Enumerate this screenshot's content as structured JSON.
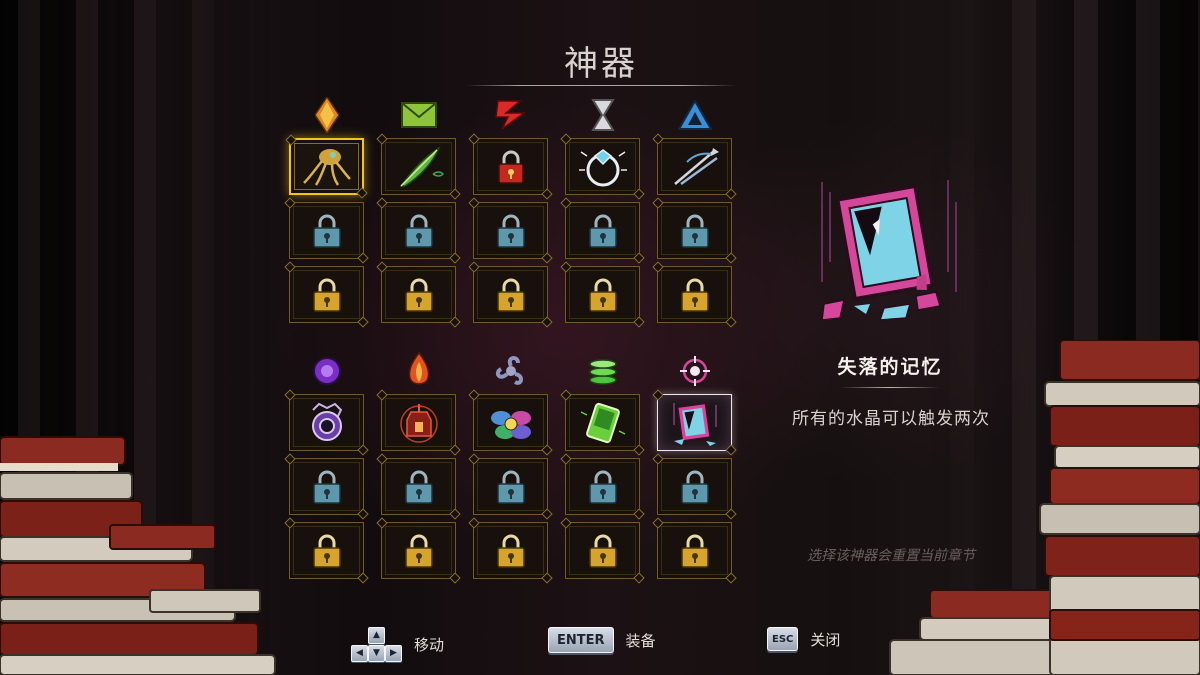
{
  "title": "神器",
  "colors": {
    "gold_frame": "#6f5a2c",
    "selected_frame": "#f2c41e",
    "lock_blue": "#5f98ad",
    "lock_gold": "#d6a42a",
    "accent_pink": "#d4479a",
    "accent_cyan": "#7ed3e6"
  },
  "grid_top": {
    "emblems": [
      "amber-diamond-icon",
      "green-envelope-icon",
      "red-rune-icon",
      "silver-hourglass-icon",
      "blue-triangle-icon"
    ],
    "columns": [
      {
        "unlocked": "tentacle-creature-artifact",
        "rows": [
          "unlocked",
          "locked-blue",
          "locked-gold"
        ]
      },
      {
        "unlocked": "green-feather-artifact",
        "rows": [
          "unlocked",
          "locked-blue",
          "locked-gold"
        ]
      },
      {
        "unlocked": "red-padlock-artifact",
        "rows": [
          "unlocked",
          "locked-blue",
          "locked-gold"
        ]
      },
      {
        "unlocked": "diamond-ring-artifact",
        "rows": [
          "unlocked",
          "locked-blue",
          "locked-gold"
        ]
      },
      {
        "unlocked": "arrows-artifact",
        "rows": [
          "unlocked",
          "locked-blue",
          "locked-gold"
        ]
      }
    ],
    "selected_column": 0
  },
  "grid_bottom": {
    "emblems": [
      "purple-orb-icon",
      "fire-gem-icon",
      "triskelion-icon",
      "green-stack-icon",
      "crosshair-icon"
    ],
    "columns": [
      {
        "unlocked": "purple-eye-artifact",
        "rows": [
          "unlocked",
          "locked-blue",
          "locked-gold"
        ]
      },
      {
        "unlocked": "red-lantern-artifact",
        "rows": [
          "unlocked",
          "locked-blue",
          "locked-gold"
        ]
      },
      {
        "unlocked": "flower-artifact",
        "rows": [
          "unlocked",
          "locked-blue",
          "locked-gold"
        ]
      },
      {
        "unlocked": "green-card-artifact",
        "rows": [
          "unlocked",
          "locked-blue",
          "locked-gold"
        ]
      },
      {
        "unlocked": "broken-mirror-artifact",
        "rows": [
          "unlocked",
          "locked-blue",
          "locked-gold"
        ]
      }
    ],
    "active_column": 4
  },
  "detail": {
    "icon": "broken-mirror-icon",
    "name": "失落的记忆",
    "description": "所有的水晶可以触发两次"
  },
  "reset_note": "选择该神器会重置当前章节",
  "controls": {
    "move": {
      "label": "移动"
    },
    "equip": {
      "key": "ENTER",
      "label": "装备"
    },
    "close": {
      "key": "ESC",
      "label": "关闭"
    }
  }
}
